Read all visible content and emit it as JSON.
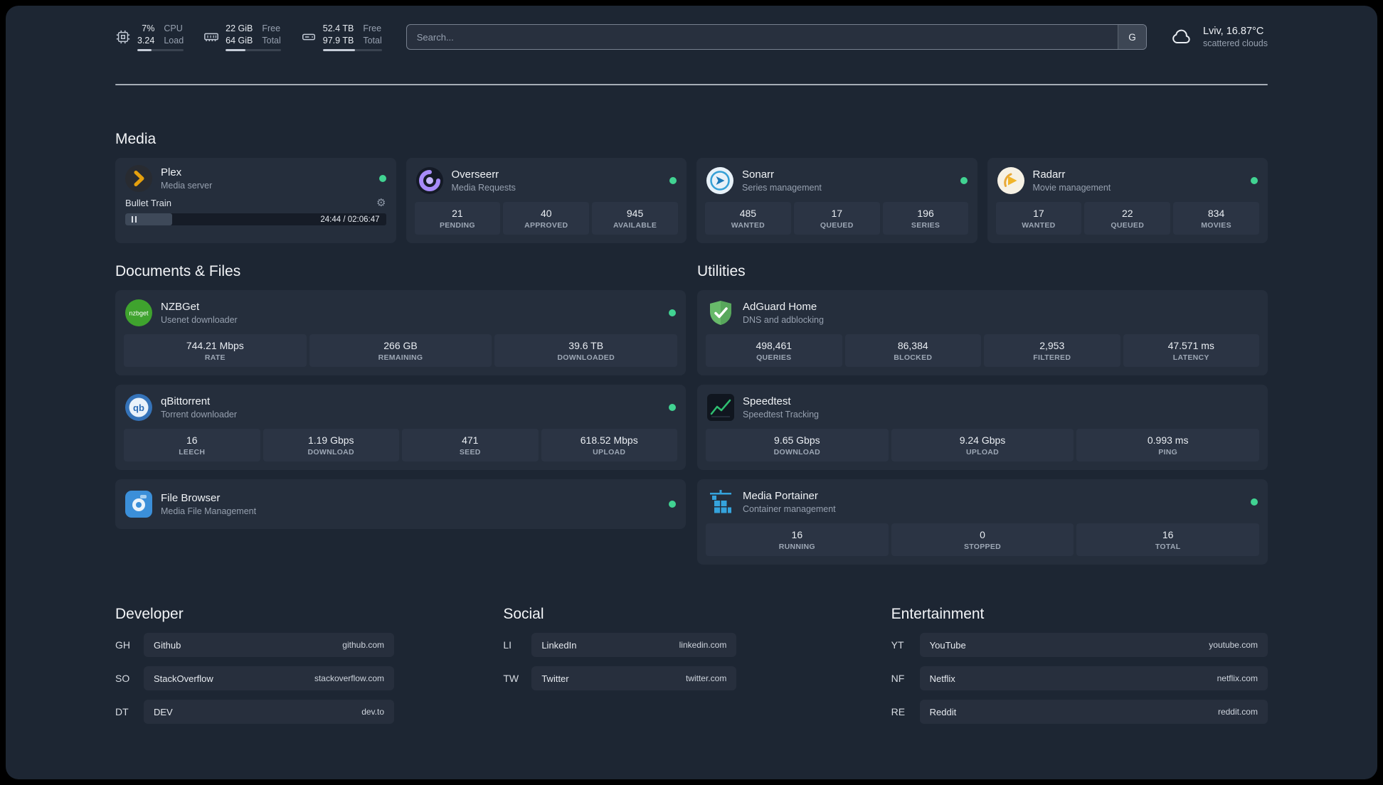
{
  "colors": {
    "status_online": "#41d392",
    "background": "#1d2633",
    "card": "#252e3c"
  },
  "topbar": {
    "cpu": {
      "value_top": "7%",
      "value_bottom": "3.24",
      "label_top": "CPU",
      "label_bottom": "Load"
    },
    "memory": {
      "value_top": "22 GiB",
      "value_bottom": "64 GiB",
      "label_top": "Free",
      "label_bottom": "Total"
    },
    "disk": {
      "value_top": "52.4 TB",
      "value_bottom": "97.9 TB",
      "label_top": "Free",
      "label_bottom": "Total"
    },
    "search": {
      "placeholder": "Search...",
      "button_label": "G"
    },
    "weather": {
      "location": "Lviv, 16.87°C",
      "condition": "scattered clouds"
    }
  },
  "sections": {
    "media": "Media",
    "documents": "Documents & Files",
    "utilities": "Utilities",
    "developer": "Developer",
    "social": "Social",
    "entertainment": "Entertainment"
  },
  "services": {
    "plex": {
      "name": "Plex",
      "subtitle": "Media server",
      "now_playing": "Bullet Train",
      "time": "24:44 / 02:06:47"
    },
    "overseerr": {
      "name": "Overseerr",
      "subtitle": "Media Requests",
      "stats": [
        {
          "value": "21",
          "label": "PENDING"
        },
        {
          "value": "40",
          "label": "APPROVED"
        },
        {
          "value": "945",
          "label": "AVAILABLE"
        }
      ]
    },
    "sonarr": {
      "name": "Sonarr",
      "subtitle": "Series management",
      "stats": [
        {
          "value": "485",
          "label": "WANTED"
        },
        {
          "value": "17",
          "label": "QUEUED"
        },
        {
          "value": "196",
          "label": "SERIES"
        }
      ]
    },
    "radarr": {
      "name": "Radarr",
      "subtitle": "Movie management",
      "stats": [
        {
          "value": "17",
          "label": "WANTED"
        },
        {
          "value": "22",
          "label": "QUEUED"
        },
        {
          "value": "834",
          "label": "MOVIES"
        }
      ]
    },
    "nzbget": {
      "name": "NZBGet",
      "subtitle": "Usenet downloader",
      "stats": [
        {
          "value": "744.21 Mbps",
          "label": "RATE"
        },
        {
          "value": "266 GB",
          "label": "REMAINING"
        },
        {
          "value": "39.6 TB",
          "label": "DOWNLOADED"
        }
      ]
    },
    "qbittorrent": {
      "name": "qBittorrent",
      "subtitle": "Torrent downloader",
      "stats": [
        {
          "value": "16",
          "label": "LEECH"
        },
        {
          "value": "1.19 Gbps",
          "label": "DOWNLOAD"
        },
        {
          "value": "471",
          "label": "SEED"
        },
        {
          "value": "618.52 Mbps",
          "label": "UPLOAD"
        }
      ]
    },
    "filebrowser": {
      "name": "File Browser",
      "subtitle": "Media File Management"
    },
    "adguard": {
      "name": "AdGuard Home",
      "subtitle": "DNS and adblocking",
      "stats": [
        {
          "value": "498,461",
          "label": "QUERIES"
        },
        {
          "value": "86,384",
          "label": "BLOCKED"
        },
        {
          "value": "2,953",
          "label": "FILTERED"
        },
        {
          "value": "47.571 ms",
          "label": "LATENCY"
        }
      ]
    },
    "speedtest": {
      "name": "Speedtest",
      "subtitle": "Speedtest Tracking",
      "stats": [
        {
          "value": "9.65 Gbps",
          "label": "DOWNLOAD"
        },
        {
          "value": "9.24 Gbps",
          "label": "UPLOAD"
        },
        {
          "value": "0.993 ms",
          "label": "PING"
        }
      ]
    },
    "portainer": {
      "name": "Media Portainer",
      "subtitle": "Container management",
      "stats": [
        {
          "value": "16",
          "label": "RUNNING"
        },
        {
          "value": "0",
          "label": "STOPPED"
        },
        {
          "value": "16",
          "label": "TOTAL"
        }
      ]
    }
  },
  "bookmarks": {
    "developer": [
      {
        "abbr": "GH",
        "name": "Github",
        "url": "github.com"
      },
      {
        "abbr": "SO",
        "name": "StackOverflow",
        "url": "stackoverflow.com"
      },
      {
        "abbr": "DT",
        "name": "DEV",
        "url": "dev.to"
      }
    ],
    "social": [
      {
        "abbr": "LI",
        "name": "LinkedIn",
        "url": "linkedin.com"
      },
      {
        "abbr": "TW",
        "name": "Twitter",
        "url": "twitter.com"
      }
    ],
    "entertainment": [
      {
        "abbr": "YT",
        "name": "YouTube",
        "url": "youtube.com"
      },
      {
        "abbr": "NF",
        "name": "Netflix",
        "url": "netflix.com"
      },
      {
        "abbr": "RE",
        "name": "Reddit",
        "url": "reddit.com"
      }
    ]
  }
}
